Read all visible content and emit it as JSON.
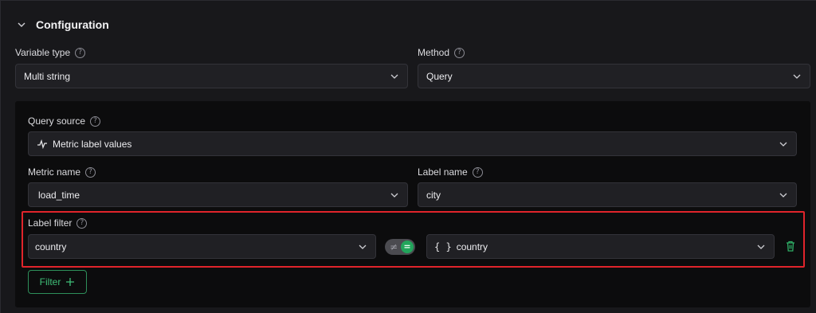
{
  "section": {
    "title": "Configuration"
  },
  "variable_type": {
    "label": "Variable type",
    "value": "Multi string"
  },
  "method": {
    "label": "Method",
    "value": "Query"
  },
  "query_source": {
    "label": "Query source",
    "value": "Metric label values"
  },
  "metric_name": {
    "label": "Metric name",
    "value": "load_time"
  },
  "label_name": {
    "label": "Label name",
    "value": "city"
  },
  "label_filter": {
    "label": "Label filter",
    "key": "country",
    "operator_off": "≠",
    "operator_on": "=",
    "value_prefix": "{ }",
    "value": "country"
  },
  "filter_button": {
    "label": "Filter"
  },
  "colors": {
    "accent": "#22a55b",
    "highlight": "#e0242b"
  }
}
